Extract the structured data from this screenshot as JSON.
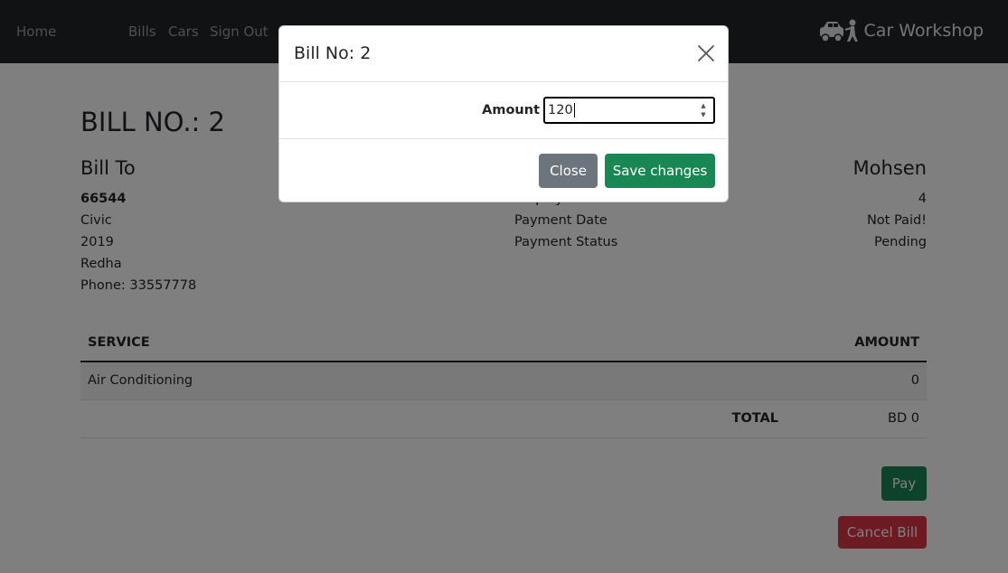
{
  "nav": {
    "home": "Home",
    "bills": "Bills",
    "cars": "Cars",
    "signout": "Sign Out",
    "brand": "Car Workshop",
    "brand_icon": "car-repair-icon"
  },
  "page": {
    "title": "BILL NO.: 2",
    "bill_to": {
      "heading": "Bill To",
      "plate": "66544",
      "model": "Civic",
      "year": "2019",
      "customer": "Redha",
      "phone": "Phone: 33557778"
    },
    "employee": {
      "name": "Mohsen",
      "fields": [
        {
          "label": "Employee No",
          "value": "4"
        },
        {
          "label": "Payment Date",
          "value": "Not Paid!"
        },
        {
          "label": "Payment Status",
          "value": "Pending"
        }
      ]
    },
    "table": {
      "headers": {
        "service": "SERVICE",
        "amount": "AMOUNT"
      },
      "rows": [
        {
          "service": "Air Conditioning",
          "amount": "0"
        }
      ],
      "total_label": "TOTAL",
      "total_value": "BD 0"
    },
    "pay_label": "Pay",
    "cancel_label": "Cancel Bill"
  },
  "modal": {
    "title": "Bill No: 2",
    "amount_label": "Amount",
    "amount_value": "120",
    "close_label": "Close",
    "save_label": "Save changes"
  },
  "colors": {
    "navbar": "#212529",
    "success": "#198754",
    "danger": "#dc3545",
    "secondary": "#6c757d"
  }
}
